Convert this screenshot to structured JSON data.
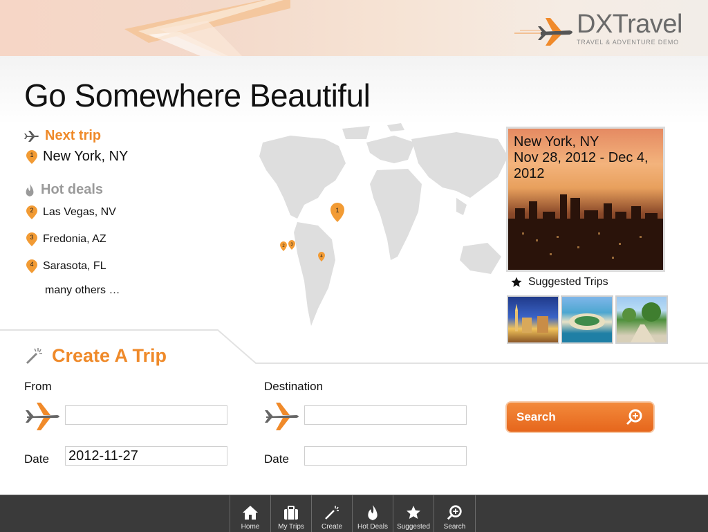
{
  "header": {
    "brand_name": "DXTravel",
    "brand_tagline": "TRAVEL & ADVENTURE DEMO"
  },
  "page": {
    "title": "Go Somewhere Beautiful"
  },
  "next_trip": {
    "heading": "Next trip",
    "icon": "airplane-icon",
    "item": {
      "marker": "1",
      "label": "New York, NY"
    }
  },
  "hot_deals": {
    "heading": "Hot deals",
    "icon": "flame-icon",
    "items": [
      {
        "marker": "2",
        "label": "Las Vegas, NV"
      },
      {
        "marker": "3",
        "label": "Fredonia, AZ"
      },
      {
        "marker": "4",
        "label": "Sarasota, FL"
      }
    ],
    "more": "many others …"
  },
  "map": {
    "markers": [
      "1",
      "2",
      "3",
      "4"
    ]
  },
  "featured": {
    "title": "New York, NY",
    "dates": "Nov 28, 2012 - Dec 4, 2012"
  },
  "suggested": {
    "label": "Suggested Trips",
    "icon": "star-icon"
  },
  "create_trip": {
    "heading": "Create A Trip",
    "from_label": "From",
    "destination_label": "Destination",
    "from_value": "",
    "destination_value": "",
    "from_date_label": "Date",
    "from_date_value": "2012-11-27",
    "dest_date_label": "Date",
    "dest_date_value": "",
    "search_label": "Search"
  },
  "bottom_nav": [
    {
      "label": "Home",
      "icon": "home-icon"
    },
    {
      "label": "My Trips",
      "icon": "suitcase-icon"
    },
    {
      "label": "Create",
      "icon": "magic-wand-icon"
    },
    {
      "label": "Hot Deals",
      "icon": "flame-icon"
    },
    {
      "label": "Suggested",
      "icon": "star-icon"
    },
    {
      "label": "Search",
      "icon": "search-icon"
    }
  ],
  "colors": {
    "accent": "#ef8a2a",
    "nav_bg": "#3a3a3a",
    "search_button": "#e6661c"
  }
}
